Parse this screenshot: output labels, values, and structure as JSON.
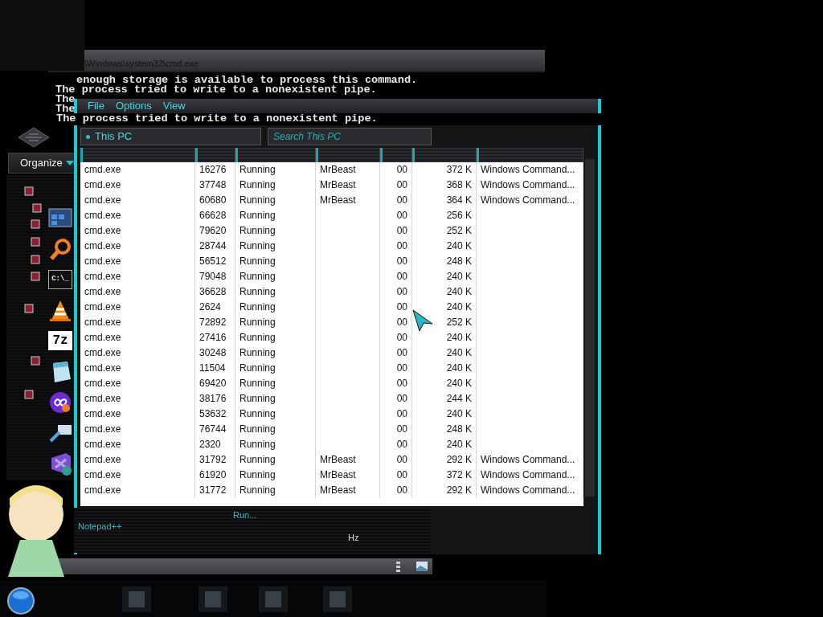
{
  "cmd_window": {
    "title": "\\Windows\\system32\\cmd.exe",
    "lines": [
      "enough storage is available to process this command.",
      "The process tried to write to a nonexistent pipe.",
      "The",
      "The"
    ],
    "overlap_line": "The process tried to write to a nonexistent pipe."
  },
  "launcher": {
    "organize": "Organize",
    "terminal_icon_text": "C:\\_",
    "archive_icon_text": "7z"
  },
  "process_window": {
    "menu": [
      "File",
      "Options",
      "View"
    ],
    "address": "This PC",
    "search": {
      "placeholder": "Search This PC"
    },
    "rows": [
      {
        "name": "cmd.exe",
        "pid": "16276",
        "status": "Running",
        "user": "MrBeast",
        "cpu": "00",
        "memory": "372 K",
        "description": "Windows Command..."
      },
      {
        "name": "cmd.exe",
        "pid": "37748",
        "status": "Running",
        "user": "MrBeast",
        "cpu": "00",
        "memory": "368 K",
        "description": "Windows Command..."
      },
      {
        "name": "cmd.exe",
        "pid": "60680",
        "status": "Running",
        "user": "MrBeast",
        "cpu": "00",
        "memory": "364 K",
        "description": "Windows Command..."
      },
      {
        "name": "cmd.exe",
        "pid": "66628",
        "status": "Running",
        "cpu": "00",
        "memory": "256 K"
      },
      {
        "name": "cmd.exe",
        "pid": "79620",
        "status": "Running",
        "cpu": "00",
        "memory": "252 K"
      },
      {
        "name": "cmd.exe",
        "pid": "28744",
        "status": "Running",
        "cpu": "00",
        "memory": "240 K"
      },
      {
        "name": "cmd.exe",
        "pid": "56512",
        "status": "Running",
        "cpu": "00",
        "memory": "248 K"
      },
      {
        "name": "cmd.exe",
        "pid": "79048",
        "status": "Running",
        "cpu": "00",
        "memory": "240 K"
      },
      {
        "name": "cmd.exe",
        "pid": "36628",
        "status": "Running",
        "cpu": "00",
        "memory": "240 K"
      },
      {
        "name": "cmd.exe",
        "pid": "2624",
        "status": "Running",
        "cpu": "00",
        "memory": "240 K"
      },
      {
        "name": "cmd.exe",
        "pid": "72892",
        "status": "Running",
        "cpu": "00",
        "memory": "252 K"
      },
      {
        "name": "cmd.exe",
        "pid": "27416",
        "status": "Running",
        "cpu": "00",
        "memory": "240 K"
      },
      {
        "name": "cmd.exe",
        "pid": "30248",
        "status": "Running",
        "cpu": "00",
        "memory": "240 K"
      },
      {
        "name": "cmd.exe",
        "pid": "11504",
        "status": "Running",
        "cpu": "00",
        "memory": "240 K"
      },
      {
        "name": "cmd.exe",
        "pid": "69420",
        "status": "Running",
        "cpu": "00",
        "memory": "240 K"
      },
      {
        "name": "cmd.exe",
        "pid": "38176",
        "status": "Running",
        "cpu": "00",
        "memory": "244 K"
      },
      {
        "name": "cmd.exe",
        "pid": "53632",
        "status": "Running",
        "cpu": "00",
        "memory": "240 K"
      },
      {
        "name": "cmd.exe",
        "pid": "76744",
        "status": "Running",
        "cpu": "00",
        "memory": "248 K"
      },
      {
        "name": "cmd.exe",
        "pid": "2320",
        "status": "Running",
        "cpu": "00",
        "memory": "240 K"
      },
      {
        "name": "cmd.exe",
        "pid": "31792",
        "status": "Running",
        "user": "MrBeast",
        "cpu": "00",
        "memory": "292 K",
        "description": "Windows Command..."
      },
      {
        "name": "cmd.exe",
        "pid": "61920",
        "status": "Running",
        "user": "MrBeast",
        "cpu": "00",
        "memory": "372 K",
        "description": "Windows Command..."
      },
      {
        "name": "cmd.exe",
        "pid": "31772",
        "status": "Running",
        "user": "MrBeast",
        "cpu": "00",
        "memory": "292 K",
        "description": "Windows Command..."
      }
    ]
  },
  "bottom_panel": {
    "items": [
      "Run...",
      "Notepad++"
    ],
    "fragment": "Hz"
  }
}
